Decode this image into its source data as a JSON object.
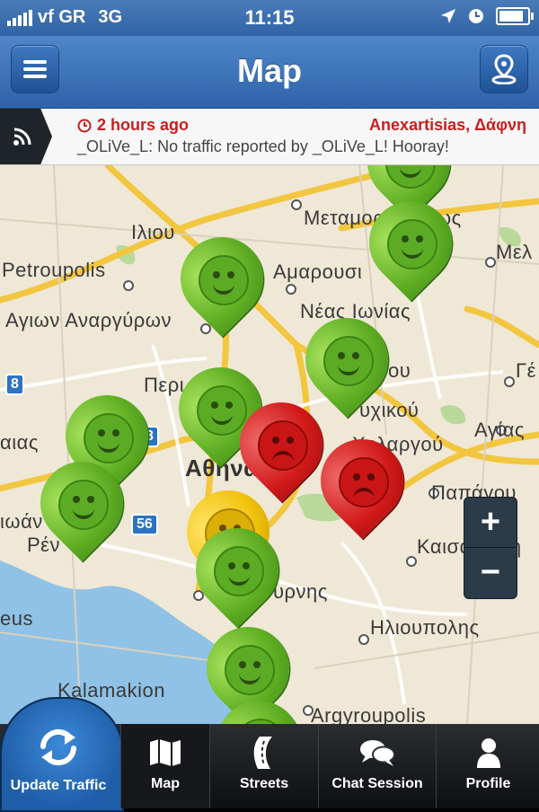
{
  "status_bar": {
    "carrier": "vf GR",
    "network": "3G",
    "time": "11:15"
  },
  "nav": {
    "title": "Map",
    "menu_icon": "menu-icon",
    "location_icon": "location-pin-icon"
  },
  "notification": {
    "time_ago": "2 hours ago",
    "location": "Anexartisias, Δάφνη",
    "message": "_OLiVe_L: No traffic reported by _OLiVe_L! Hooray!"
  },
  "map": {
    "places": [
      "Ιλιου",
      "Petroupolis",
      "Αγιων Αναργύρων",
      "Μεταμορφώσεως",
      "Μελ",
      "Αμαρουσι",
      "Νέας Ιωνίας",
      "Περι",
      "Γέ",
      "ου",
      "υχικού",
      "Αγίας",
      "αιας",
      "Χολαργού",
      "Αθηνα",
      "Παπάγου",
      "ιωάν",
      "Ρέν",
      "Καισαριανή",
      "υρνης",
      "eus",
      "Ηλιουπολης",
      "Kalamakion",
      "Argyroupolis"
    ],
    "highways": [
      "8",
      "8",
      "56"
    ],
    "markers": [
      {
        "status": "green"
      },
      {
        "status": "green"
      },
      {
        "status": "green"
      },
      {
        "status": "green"
      },
      {
        "status": "green"
      },
      {
        "status": "green"
      },
      {
        "status": "green"
      },
      {
        "status": "red"
      },
      {
        "status": "red"
      },
      {
        "status": "yellow"
      },
      {
        "status": "green"
      },
      {
        "status": "green"
      },
      {
        "status": "green"
      }
    ],
    "zoom_in": "+",
    "zoom_out": "−"
  },
  "tabs": [
    {
      "label": "Update Traffic",
      "icon": "refresh-arrows-icon"
    },
    {
      "label": "Map",
      "icon": "folded-map-icon"
    },
    {
      "label": "Streets",
      "icon": "road-icon"
    },
    {
      "label": "Chat Session",
      "icon": "chat-bubbles-icon"
    },
    {
      "label": "Profile",
      "icon": "person-icon"
    }
  ],
  "colors": {
    "nav_blue": "#3a72b9",
    "alert_red": "#c71f1f",
    "pin_green": "#5fae23",
    "pin_red": "#d21a1a",
    "pin_yellow": "#f2c20d"
  }
}
